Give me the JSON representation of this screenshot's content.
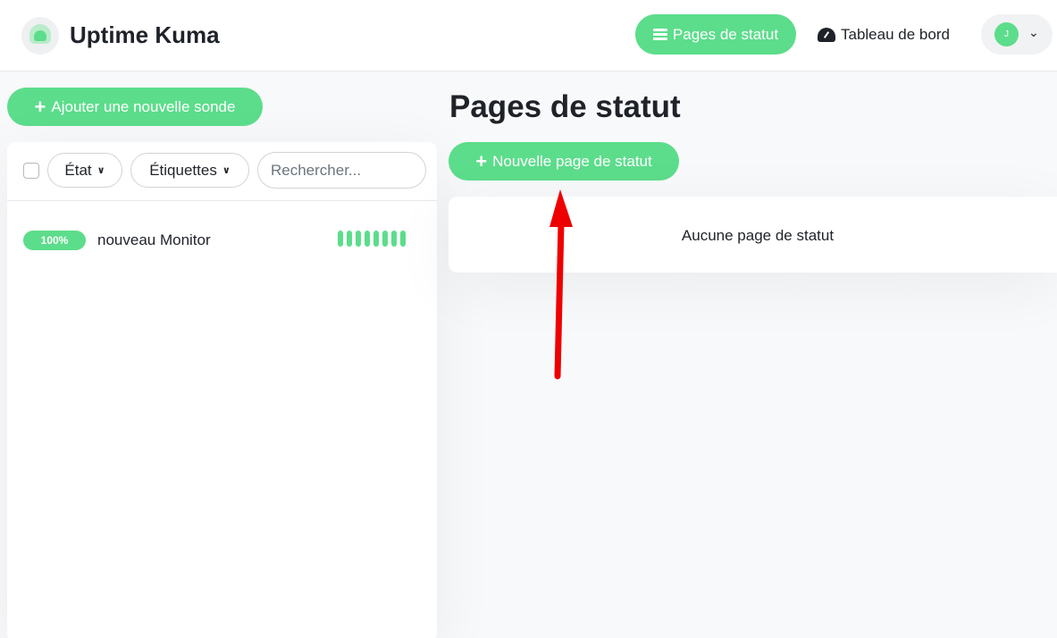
{
  "app": {
    "title": "Uptime Kuma"
  },
  "nav": {
    "status_pages_label": "Pages de statut",
    "dashboard_label": "Tableau de bord",
    "avatar_initial": "J"
  },
  "sidebar": {
    "add_monitor_label": "Ajouter une nouvelle sonde",
    "filters": {
      "state_label": "État",
      "tags_label": "Étiquettes"
    },
    "search": {
      "placeholder": "Rechercher...",
      "value": ""
    },
    "monitors": [
      {
        "uptime": "100%",
        "name": "nouveau Monitor",
        "heartbeats": 8
      }
    ]
  },
  "main": {
    "title": "Pages de statut",
    "new_page_label": "Nouvelle page de statut",
    "empty_message": "Aucune page de statut"
  },
  "colors": {
    "accent": "#5cdd8b",
    "annotation_arrow": "#ee0000"
  },
  "icons": {
    "logo": "uptime-kuma-logo",
    "status_pages": "list-icon",
    "dashboard": "tachometer-icon",
    "add": "plus-icon",
    "dropdown": "chevron-down-icon"
  }
}
